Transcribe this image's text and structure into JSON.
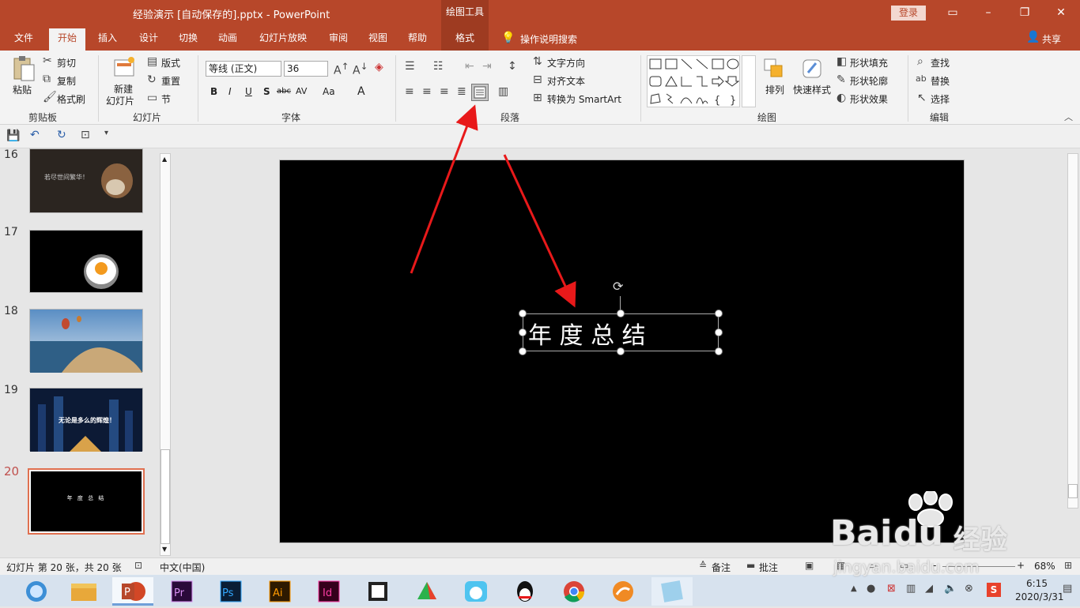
{
  "titlebar": {
    "title": "经验演示 [自动保存的].pptx  -  PowerPoint",
    "context_tab": "绘图工具",
    "login": "登录",
    "minimize": "–",
    "restore": "❐",
    "close": "✕",
    "ribbon_opts": "▭"
  },
  "tabs": [
    {
      "label": "文件"
    },
    {
      "label": "开始"
    },
    {
      "label": "插入"
    },
    {
      "label": "设计"
    },
    {
      "label": "切换"
    },
    {
      "label": "动画"
    },
    {
      "label": "幻灯片放映"
    },
    {
      "label": "审阅"
    },
    {
      "label": "视图"
    },
    {
      "label": "帮助"
    },
    {
      "label": "格式"
    }
  ],
  "tellme": "操作说明搜索",
  "share": "共享",
  "ribbon": {
    "clipboard": {
      "paste": "粘贴",
      "cut": "剪切",
      "copy": "复制",
      "format_painter": "格式刷",
      "label": "剪贴板"
    },
    "slides": {
      "new_slide_1": "新建",
      "new_slide_2": "幻灯片",
      "layout": "版式",
      "reset": "重置",
      "section": "节",
      "label": "幻灯片"
    },
    "font": {
      "font_name": "等线 (正文)",
      "font_size": "36",
      "label": "字体",
      "bold": "B",
      "italic": "I",
      "underline": "U",
      "shadow": "S",
      "strike": "abc",
      "spacing": "AV",
      "case": "Aa",
      "color": "A"
    },
    "paragraph": {
      "text_direction": "文字方向",
      "align_text": "对齐文本",
      "smartart": "转换为 SmartArt",
      "label": "段落"
    },
    "drawing": {
      "arrange": "排列",
      "quick_styles": "快速样式",
      "shape_fill": "形状填充",
      "shape_outline": "形状轮廓",
      "shape_effects": "形状效果",
      "label": "绘图"
    },
    "editing": {
      "find": "查找",
      "replace": "替换",
      "select": "选择",
      "label": "编辑"
    }
  },
  "thumbnails": [
    {
      "num": "16",
      "caption": "若尽世间繁华！"
    },
    {
      "num": "17",
      "caption": ""
    },
    {
      "num": "18",
      "caption": ""
    },
    {
      "num": "19",
      "caption": "无论是多么的辉煌！"
    },
    {
      "num": "20",
      "caption": "年 度 总 结"
    }
  ],
  "slide": {
    "textbox": "年  度  总  结"
  },
  "status": {
    "slide_info": "幻灯片 第 20 张，共 20 张",
    "language": "中文(中国)",
    "notes": "备注",
    "comments": "批注",
    "zoom": "68%",
    "zoom_minus": "-",
    "zoom_plus": "+"
  },
  "taskbar": {
    "time": "6:15",
    "date": "2020/3/31"
  },
  "watermark": {
    "brand": "Bai",
    "brand2": "du",
    "jingyan": "经验",
    "url": "jingyan.baidu.com"
  },
  "colors": {
    "accent": "#b7472a",
    "arrow": "#e8191a"
  }
}
